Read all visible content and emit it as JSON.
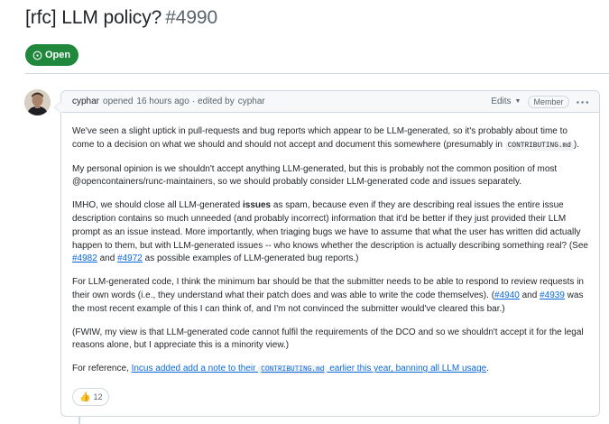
{
  "issue": {
    "title": "[rfc] LLM policy?",
    "number": "#4990",
    "state": "Open",
    "state_color": "#1f883d"
  },
  "comment": {
    "author": "cyphar",
    "opened_text": "opened",
    "time": "16 hours ago",
    "sep": "·",
    "edited_text": "edited by",
    "editor": "cyphar",
    "edits_label": "Edits",
    "role_badge": "Member",
    "menu_icon": "kebab-horizontal-icon",
    "p1_a": "We've seen a slight uptick in pull-requests and bug reports which appear to be LLM-generated, so it's probably about time to come to a decision on what we should and should not accept and document this somewhere (presumably in ",
    "p1_code": "CONTRIBUTING.md",
    "p1_b": ").",
    "p2": "My personal opinion is we shouldn't accept anything LLM-generated, but this is probably not the common position of most @opencontainers/runc-maintainers, so we should probably consider LLM-generated code and issues separately.",
    "p3_a": "IMHO, we should close all LLM-generated ",
    "p3_bold": "issues",
    "p3_b": " as spam, because even if they are describing real issues the entire issue description contains so much unneeded (and probably incorrect) information that it'd be better if they just provided their LLM prompt as an issue instead. More importantly, when triaging bugs we have to assume that what the user has written did actually happen to them, but with LLM-generated issues -- who knows whether the description is actually describing something real? (See ",
    "p3_link1": "#4982",
    "p3_and": " and ",
    "p3_link2": "#4972",
    "p3_c": " as possible examples of LLM-generated bug reports.)",
    "p4_a": "For LLM-generated code, I think the minimum bar should be that the submitter needs to be able to respond to review requests in their own words (i.e., they understand what their patch does and was able to write the code themselves). (",
    "p4_link1": "#4940",
    "p4_and": " and ",
    "p4_link2": "#4939",
    "p4_b": " was the most recent example of this I can think of, and I'm not convinced the submitter would've cleared this bar.)",
    "p5": "(FWIW, my view is that LLM-generated code cannot fulfil the requirements of the DCO and so we shouldn't accept it for the legal reasons alone, but I appreciate this is a minority view.)",
    "p6_a": "For reference, ",
    "p6_link_a": "Incus added add a note to their ",
    "p6_link_code": "CONTRIBUTING.md",
    "p6_link_b": " earlier this year, banning all LLM usage",
    "p6_b": ".",
    "reaction_emoji": "👍",
    "reaction_count": "12"
  },
  "colors": {
    "link": "#0969da",
    "border": "#d1d9e0",
    "muted": "#59636e"
  }
}
